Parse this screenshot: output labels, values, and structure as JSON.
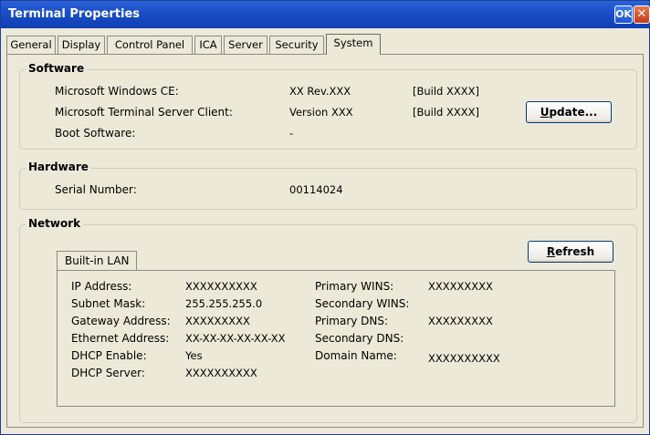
{
  "window": {
    "title": "Terminal Properties",
    "ok_label": "OK",
    "close_label": "✕"
  },
  "tabs": [
    {
      "label": "General"
    },
    {
      "label": "Display"
    },
    {
      "label": "Control Panel"
    },
    {
      "label": "ICA"
    },
    {
      "label": "Server"
    },
    {
      "label": "Security"
    },
    {
      "label": "System",
      "selected": true
    }
  ],
  "software": {
    "title": "Software",
    "rows": [
      {
        "label": "Microsoft Windows CE:",
        "version": "XX Rev.XXX",
        "build": "[Build XXXX]"
      },
      {
        "label": "Microsoft Terminal Server Client:",
        "version": "Version XXX",
        "build": "[Build XXXX]"
      },
      {
        "label": "Boot Software:",
        "version": "-",
        "build": ""
      }
    ],
    "update_label_pre": "",
    "update_label_u": "U",
    "update_label_post": "pdate..."
  },
  "hardware": {
    "title": "Hardware",
    "serial_label": "Serial Number:",
    "serial_value": "00114024"
  },
  "network": {
    "title": "Network",
    "subtab_label": "Built-in LAN",
    "refresh_u": "R",
    "refresh_post": "efresh",
    "left": [
      {
        "label": "IP Address:",
        "value": "XXXXXXXXXX"
      },
      {
        "label": "Subnet Mask:",
        "value": "255.255.255.0"
      },
      {
        "label": "Gateway Address:",
        "value": "XXXXXXXXX"
      },
      {
        "label": "Ethernet Address:",
        "value": "XX-XX-XX-XX-XX-XX"
      },
      {
        "label": "DHCP Enable:",
        "value": "Yes"
      },
      {
        "label": "DHCP Server:",
        "value": "XXXXXXXXXX"
      }
    ],
    "right": [
      {
        "label": "Primary WINS:",
        "value": "XXXXXXXXX"
      },
      {
        "label": "Secondary WINS:",
        "value": ""
      },
      {
        "label": "Primary DNS:",
        "value": "XXXXXXXXX"
      },
      {
        "label": "Secondary DNS:",
        "value": ""
      },
      {
        "label": "Domain Name:",
        "value": "XXXXXXXXXX"
      }
    ]
  }
}
